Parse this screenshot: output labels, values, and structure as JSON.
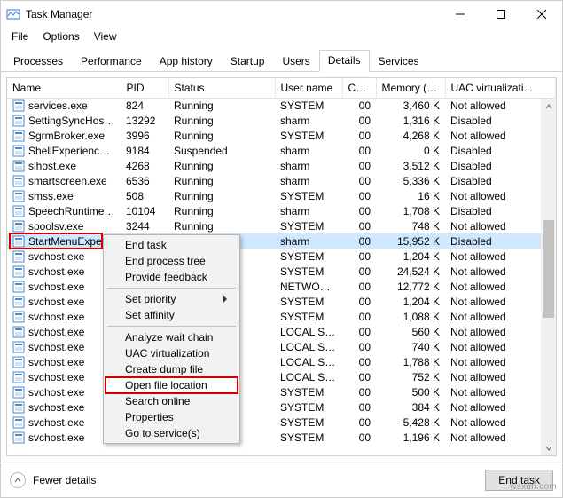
{
  "window": {
    "title": "Task Manager",
    "min": "Minimize",
    "max": "Maximize",
    "close": "Close"
  },
  "menu": {
    "file": "File",
    "options": "Options",
    "view": "View"
  },
  "tabs": {
    "processes": "Processes",
    "performance": "Performance",
    "app_history": "App history",
    "startup": "Startup",
    "users": "Users",
    "details": "Details",
    "services": "Services"
  },
  "columns": {
    "name": "Name",
    "pid": "PID",
    "status": "Status",
    "user": "User name",
    "cpu": "CPU",
    "mem": "Memory (ac...",
    "uac": "UAC virtualizati..."
  },
  "rows": [
    {
      "name": "services.exe",
      "pid": "824",
      "status": "Running",
      "user": "SYSTEM",
      "cpu": "00",
      "mem": "3,460 K",
      "uac": "Not allowed"
    },
    {
      "name": "SettingSyncHost.exe",
      "pid": "13292",
      "status": "Running",
      "user": "sharm",
      "cpu": "00",
      "mem": "1,316 K",
      "uac": "Disabled"
    },
    {
      "name": "SgrmBroker.exe",
      "pid": "3996",
      "status": "Running",
      "user": "SYSTEM",
      "cpu": "00",
      "mem": "4,268 K",
      "uac": "Not allowed"
    },
    {
      "name": "ShellExperienceHost....",
      "pid": "9184",
      "status": "Suspended",
      "user": "sharm",
      "cpu": "00",
      "mem": "0 K",
      "uac": "Disabled"
    },
    {
      "name": "sihost.exe",
      "pid": "4268",
      "status": "Running",
      "user": "sharm",
      "cpu": "00",
      "mem": "3,512 K",
      "uac": "Disabled"
    },
    {
      "name": "smartscreen.exe",
      "pid": "6536",
      "status": "Running",
      "user": "sharm",
      "cpu": "00",
      "mem": "5,336 K",
      "uac": "Disabled"
    },
    {
      "name": "smss.exe",
      "pid": "508",
      "status": "Running",
      "user": "SYSTEM",
      "cpu": "00",
      "mem": "16 K",
      "uac": "Not allowed"
    },
    {
      "name": "SpeechRuntime.exe",
      "pid": "10104",
      "status": "Running",
      "user": "sharm",
      "cpu": "00",
      "mem": "1,708 K",
      "uac": "Disabled"
    },
    {
      "name": "spoolsv.exe",
      "pid": "3244",
      "status": "Running",
      "user": "SYSTEM",
      "cpu": "00",
      "mem": "748 K",
      "uac": "Not allowed"
    },
    {
      "name": "StartMenuExpe",
      "pid": "",
      "status": "",
      "user": "sharm",
      "cpu": "00",
      "mem": "15,952 K",
      "uac": "Disabled",
      "selected": true
    },
    {
      "name": "svchost.exe",
      "pid": "",
      "status": "",
      "user": "SYSTEM",
      "cpu": "00",
      "mem": "1,204 K",
      "uac": "Not allowed"
    },
    {
      "name": "svchost.exe",
      "pid": "",
      "status": "",
      "user": "SYSTEM",
      "cpu": "00",
      "mem": "24,524 K",
      "uac": "Not allowed"
    },
    {
      "name": "svchost.exe",
      "pid": "",
      "status": "",
      "user": "NETWORK ...",
      "cpu": "00",
      "mem": "12,772 K",
      "uac": "Not allowed"
    },
    {
      "name": "svchost.exe",
      "pid": "",
      "status": "",
      "user": "SYSTEM",
      "cpu": "00",
      "mem": "1,204 K",
      "uac": "Not allowed"
    },
    {
      "name": "svchost.exe",
      "pid": "",
      "status": "",
      "user": "SYSTEM",
      "cpu": "00",
      "mem": "1,088 K",
      "uac": "Not allowed"
    },
    {
      "name": "svchost.exe",
      "pid": "",
      "status": "",
      "user": "LOCAL SER...",
      "cpu": "00",
      "mem": "560 K",
      "uac": "Not allowed"
    },
    {
      "name": "svchost.exe",
      "pid": "",
      "status": "",
      "user": "LOCAL SER...",
      "cpu": "00",
      "mem": "740 K",
      "uac": "Not allowed"
    },
    {
      "name": "svchost.exe",
      "pid": "",
      "status": "",
      "user": "LOCAL SER...",
      "cpu": "00",
      "mem": "1,788 K",
      "uac": "Not allowed"
    },
    {
      "name": "svchost.exe",
      "pid": "",
      "status": "",
      "user": "LOCAL SER...",
      "cpu": "00",
      "mem": "752 K",
      "uac": "Not allowed"
    },
    {
      "name": "svchost.exe",
      "pid": "",
      "status": "",
      "user": "SYSTEM",
      "cpu": "00",
      "mem": "500 K",
      "uac": "Not allowed"
    },
    {
      "name": "svchost.exe",
      "pid": "",
      "status": "",
      "user": "SYSTEM",
      "cpu": "00",
      "mem": "384 K",
      "uac": "Not allowed"
    },
    {
      "name": "svchost.exe",
      "pid": "",
      "status": "",
      "user": "SYSTEM",
      "cpu": "00",
      "mem": "5,428 K",
      "uac": "Not allowed"
    },
    {
      "name": "svchost.exe",
      "pid": "",
      "status": "",
      "user": "SYSTEM",
      "cpu": "00",
      "mem": "1,196 K",
      "uac": "Not allowed"
    }
  ],
  "context_menu": {
    "end_task": "End task",
    "end_tree": "End process tree",
    "feedback": "Provide feedback",
    "set_priority": "Set priority",
    "set_affinity": "Set affinity",
    "analyze": "Analyze wait chain",
    "uac": "UAC virtualization",
    "dump": "Create dump file",
    "open_loc": "Open file location",
    "search": "Search online",
    "properties": "Properties",
    "services": "Go to service(s)"
  },
  "footer": {
    "fewer": "Fewer details",
    "end_task": "End task"
  },
  "watermark": "wsxdn.com"
}
